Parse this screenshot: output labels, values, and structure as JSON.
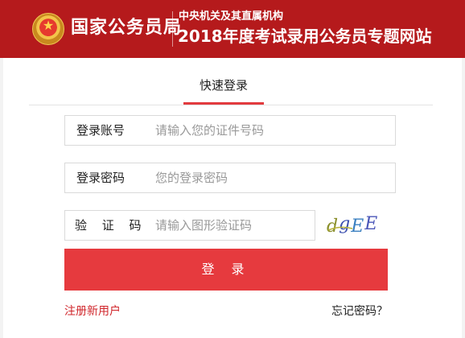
{
  "header": {
    "brand": "国家公务员局",
    "subtitle_top": "中央机关及其直属机构",
    "subtitle_main": "2018年度考试录用公务员专题网站"
  },
  "login": {
    "tab_label": "快速登录",
    "account": {
      "label": "登录账号",
      "placeholder": "请输入您的证件号码"
    },
    "password": {
      "label": "登录密码",
      "placeholder": "您的登录密码"
    },
    "captcha": {
      "label": "验 证 码",
      "placeholder": "请输入图形验证码",
      "image_text": "dgEE"
    },
    "submit_label": "登 录",
    "register_link": "注册新用户",
    "forgot_link": "忘记密码？"
  },
  "colors": {
    "header_bg": "#b51a1c",
    "accent": "#e63a3e",
    "link_red": "#d0272c"
  },
  "icons": {
    "emblem": "national-emblem-icon"
  }
}
